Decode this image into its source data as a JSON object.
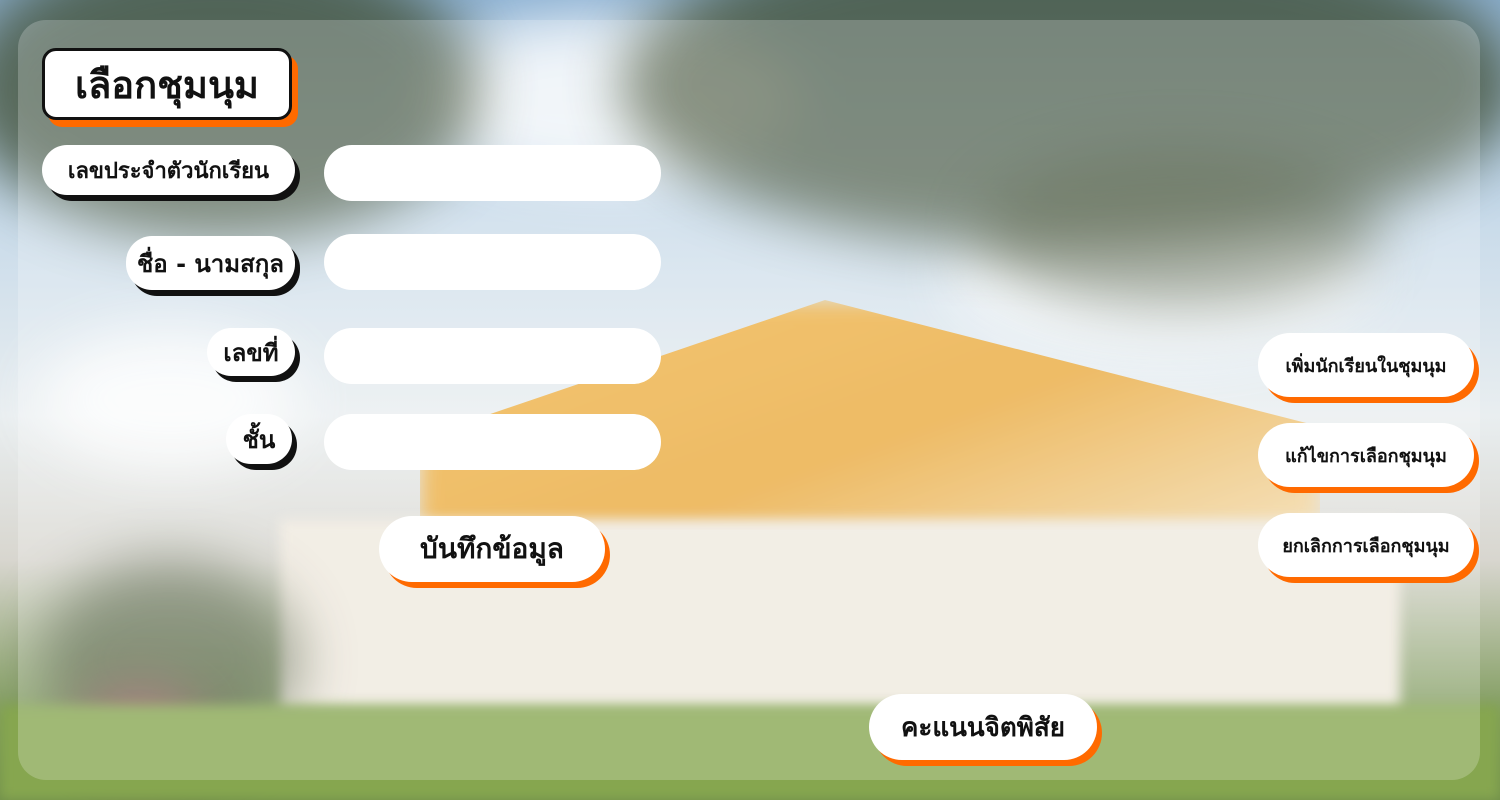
{
  "page": {
    "title": "เลือกชุมนุม"
  },
  "form": {
    "student_id_label": "เลขประจำตัวนักเรียน",
    "full_name_label": "ชื่อ - นามสกุล",
    "number_label": "เลขที่",
    "class_label": "ชั้น",
    "student_id_value": "",
    "full_name_value": "",
    "number_value": "",
    "class_value": "",
    "save_label": "บันทึกข้อมูล"
  },
  "actions": {
    "add_student_label": "เพิ่มนักเรียนในชุมนุม",
    "edit_selection_label": "แก้ไขการเลือกชุมนุม",
    "cancel_selection_label": "ยกเลิกการเลือกชุมนุม",
    "character_score_label": "คะแนนจิตพิสัย"
  },
  "colors": {
    "accent": "#ff6a00",
    "shadow": "#111111",
    "pill_bg": "#ffffff"
  }
}
